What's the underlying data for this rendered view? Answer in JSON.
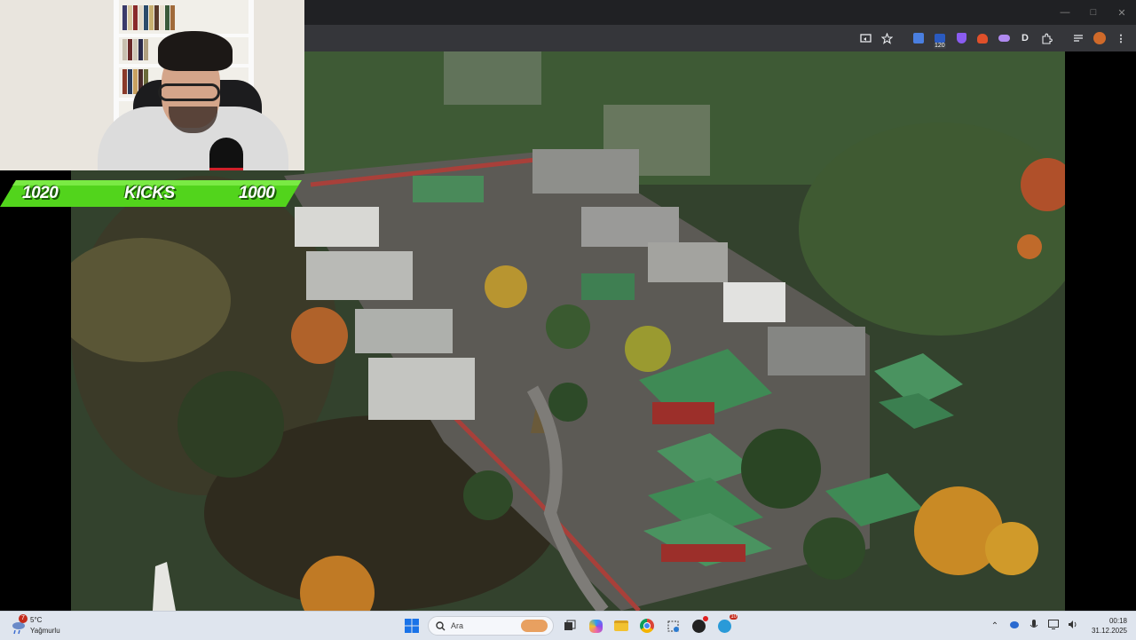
{
  "kicks": {
    "left_value": "1020",
    "label": "KICKS",
    "right_value": "1000"
  },
  "taskbar": {
    "weather": {
      "temperature": "5°C",
      "condition": "Yağmurlu",
      "notification_count": "7"
    },
    "search_placeholder": "Ara",
    "teams_badge": "10",
    "clock": {
      "time": "00:18",
      "date": "31.12.2025"
    }
  },
  "browser": {
    "extension_badge": "120"
  },
  "colors": {
    "kicks_green": "#52d41c",
    "taskbar_bg": "#dfe5ee",
    "toolbar_bg": "#35363a"
  },
  "icons": [
    "cast-icon",
    "star-icon",
    "translate-icon",
    "extension-icon",
    "shield-icon",
    "fox-icon",
    "cloud-icon",
    "d-icon",
    "puzzle-icon",
    "queue-icon",
    "avatar-icon",
    "more-icon",
    "windows-start-icon",
    "search-icon",
    "task-view-icon",
    "copilot-icon",
    "file-explorer-icon",
    "chrome-icon",
    "snipping-icon",
    "app-icon",
    "teams-icon",
    "chevron-up-icon",
    "network-icon",
    "mic-icon",
    "display-icon",
    "volume-icon"
  ]
}
